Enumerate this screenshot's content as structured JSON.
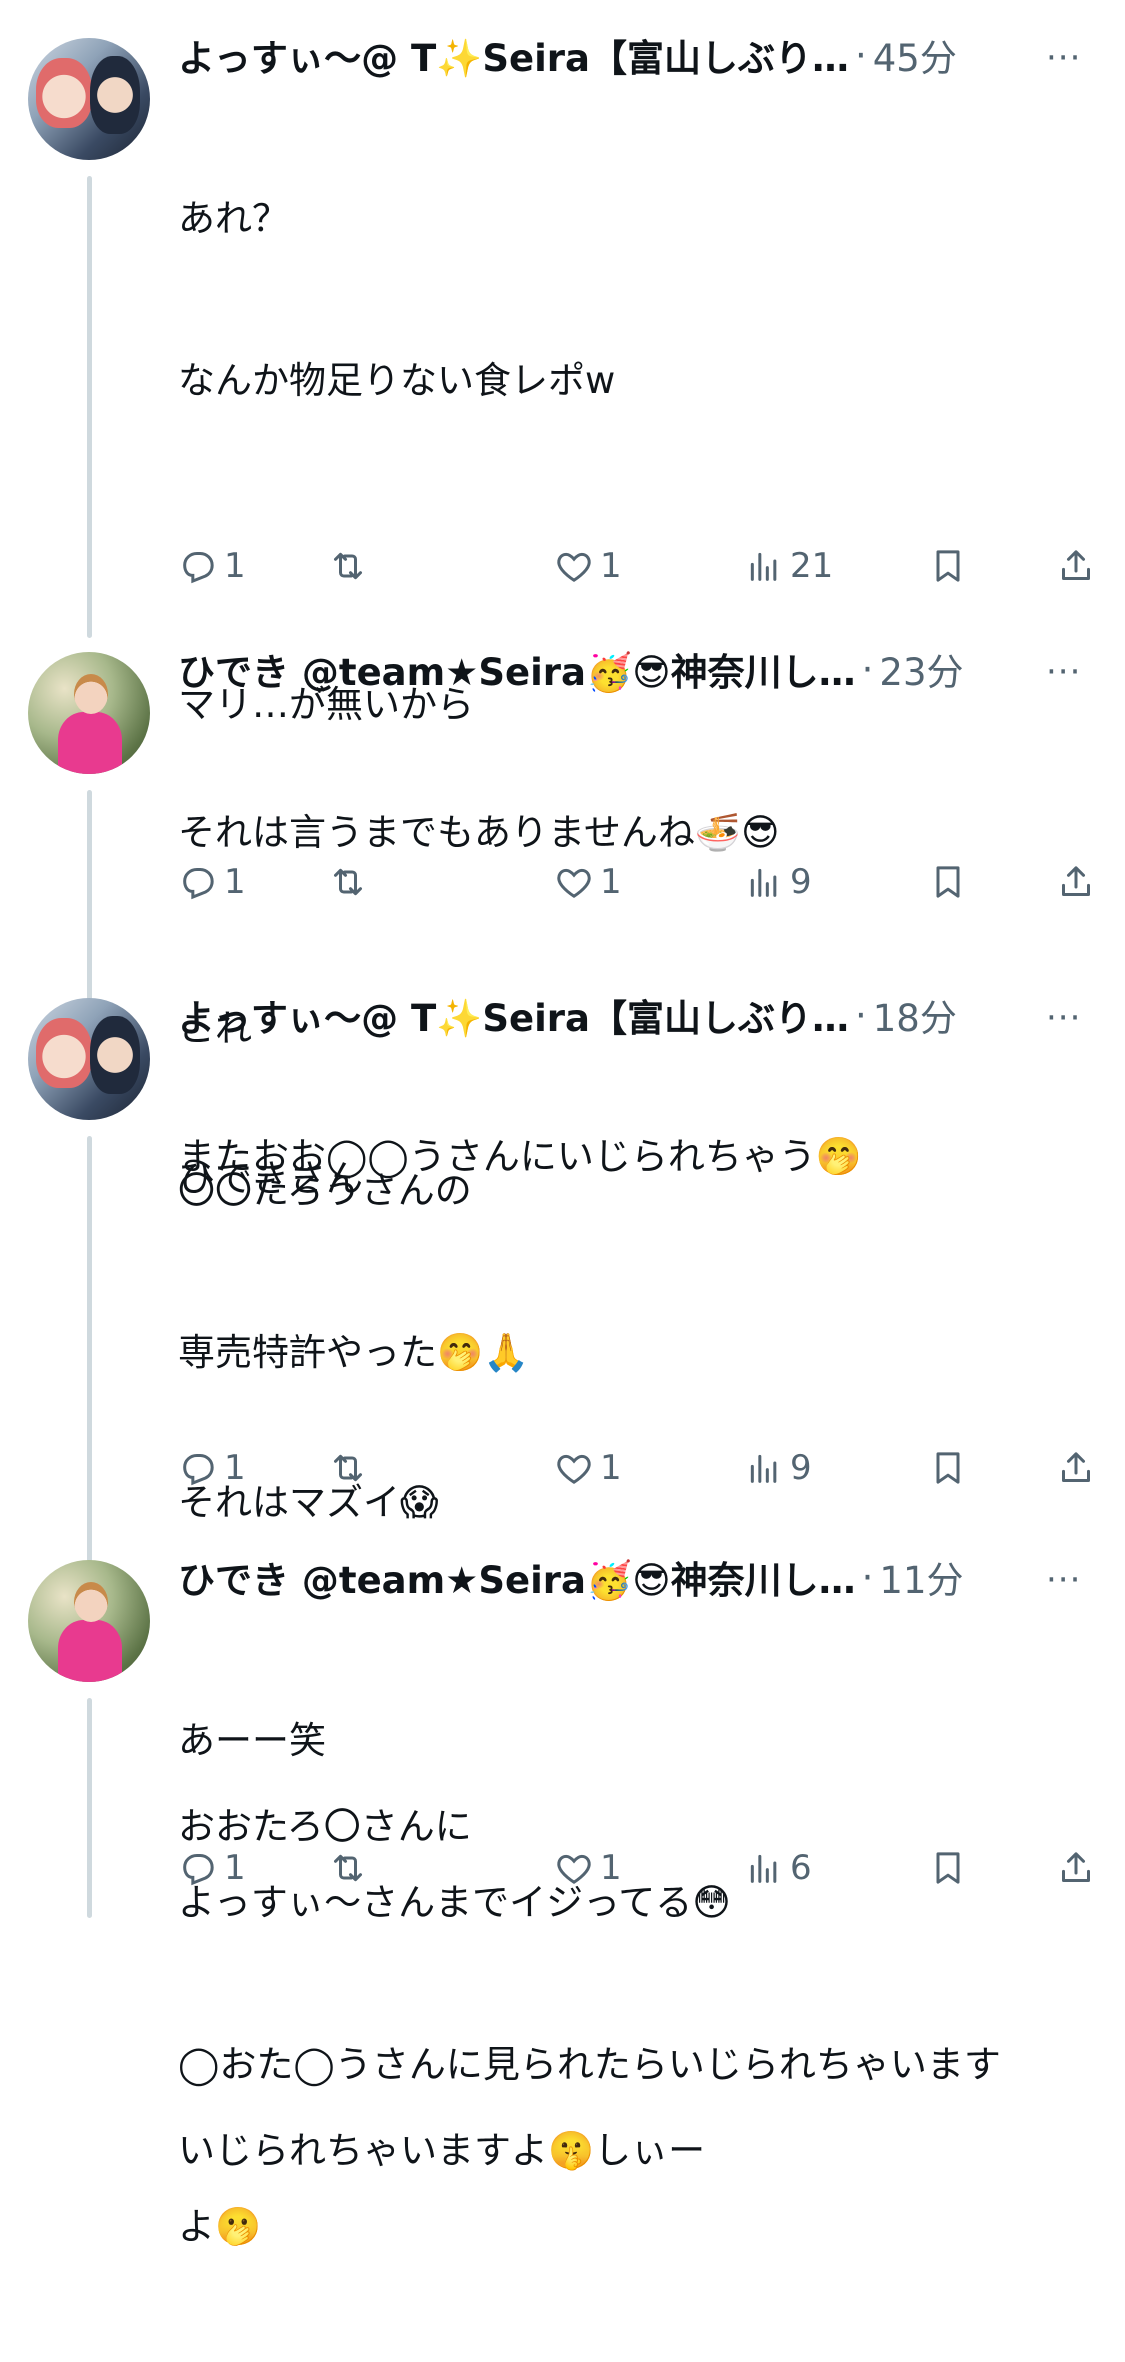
{
  "tweets": [
    {
      "author": "よっすぃ〜@ T✨Seira【富山しぶり…",
      "time": "45分",
      "more": "···",
      "lines": [
        "あれ？",
        "なんか物足りない食レポw",
        "",
        "マリ…が無いから",
        "",
        "これ",
        "〇〇たろうさんの",
        "専売特許やった🤭🙏"
      ],
      "actions": {
        "replies": "1",
        "retweets": "",
        "likes": "1",
        "views": "21"
      }
    },
    {
      "author": "ひでき @team★Seira🥳😎神奈川し…",
      "time": "23分",
      "more": "···",
      "lines": [
        "それは言うまでもありませんね🍜😎",
        "",
        "またおお◯◯うさんにいじられちゃう🤭"
      ],
      "actions": {
        "replies": "1",
        "retweets": "",
        "likes": "1",
        "views": "9"
      }
    },
    {
      "author": "よっすぃ〜@ T✨Seira【富山しぶり…",
      "time": "18分",
      "more": "···",
      "lines": [
        "ひできさん",
        "",
        "それはマズイ😱",
        "",
        "おおたろ〇さんに",
        "",
        "いじられちゃいますよ🤫しぃー"
      ],
      "actions": {
        "replies": "1",
        "retweets": "",
        "likes": "1",
        "views": "9"
      }
    },
    {
      "author": "ひでき @team★Seira🥳😎神奈川し…",
      "time": "11分",
      "more": "···",
      "lines": [
        "あーー笑",
        "よっすぃ〜さんまでイジってる😳",
        "◯おた◯うさんに見られたらいじられちゃいます",
        "よ🫢"
      ],
      "actions": {
        "replies": "1",
        "retweets": "",
        "likes": "1",
        "views": "6"
      }
    }
  ]
}
